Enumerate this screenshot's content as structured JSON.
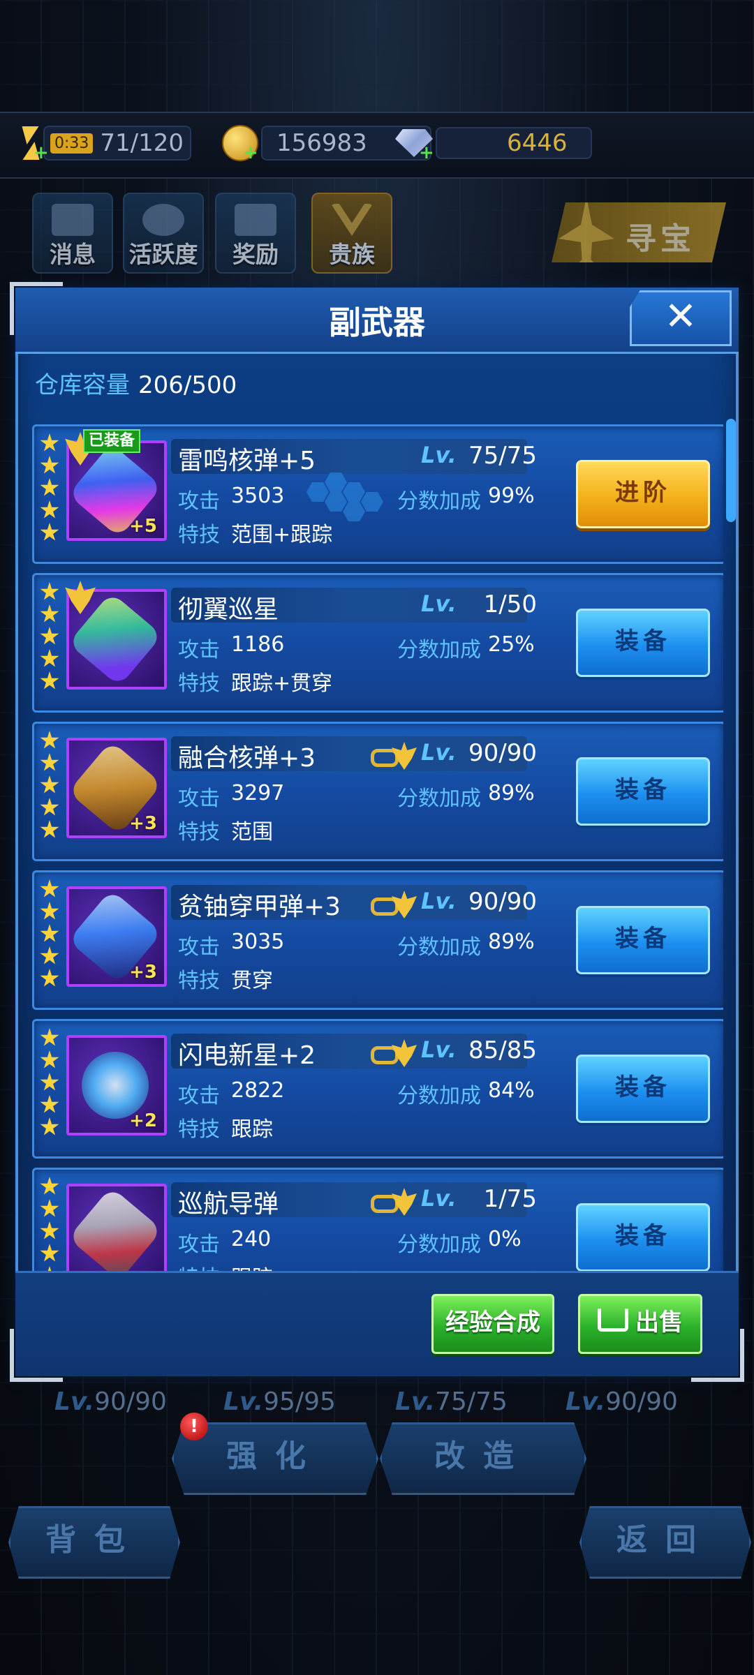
{
  "resources": {
    "energy_timer": "0:33",
    "energy": "71/120",
    "coins": "156983",
    "gems": "6446"
  },
  "menu": [
    {
      "label": "消息",
      "icon": "message-icon"
    },
    {
      "label": "活跃度",
      "icon": "smiley-badge-icon"
    },
    {
      "label": "奖励",
      "icon": "gift-icon"
    },
    {
      "label": "贵族",
      "icon": "noble-chevron-icon"
    }
  ],
  "treasure_label": "寻宝",
  "panel": {
    "title": "副武器",
    "close": "✕",
    "capacity_label": "仓库容量",
    "capacity_value": "206/500",
    "labels": {
      "atk": "攻击",
      "score": "分数加成",
      "skill": "特技",
      "lv": "Lv."
    },
    "equipped_tag": "已装备",
    "items": [
      {
        "name": "雷鸣核弹+5",
        "lv": "75/75",
        "atk": "3503",
        "score": "99%",
        "skill": "范围+跟踪",
        "plus": "+5",
        "button": "进阶"
      },
      {
        "name": "彻翼巡星",
        "lv": "1/50",
        "atk": "1186",
        "score": "25%",
        "skill": "跟踪+贯穿",
        "plus": "",
        "button": "装备"
      },
      {
        "name": "融合核弹+3",
        "lv": "90/90",
        "atk": "3297",
        "score": "89%",
        "skill": "范围",
        "plus": "+3",
        "button": "装备"
      },
      {
        "name": "贫铀穿甲弹+3",
        "lv": "90/90",
        "atk": "3035",
        "score": "89%",
        "skill": "贯穿",
        "plus": "+3",
        "button": "装备"
      },
      {
        "name": "闪电新星+2",
        "lv": "85/85",
        "atk": "2822",
        "score": "84%",
        "skill": "跟踪",
        "plus": "+2",
        "button": "装备"
      },
      {
        "name": "巡航导弹",
        "lv": "1/75",
        "atk": "240",
        "score": "0%",
        "skill": "跟踪",
        "plus": "",
        "button": "装备"
      }
    ],
    "exp_button": "经验合成",
    "sell_button": "出售"
  },
  "behind": {
    "levels": [
      "90/90",
      "95/95",
      "75/75",
      "90/90"
    ],
    "lv_prefix": "Lv.",
    "enhance": "强化",
    "modify": "改造",
    "bag": "背包",
    "back": "返回",
    "alert": "!"
  }
}
